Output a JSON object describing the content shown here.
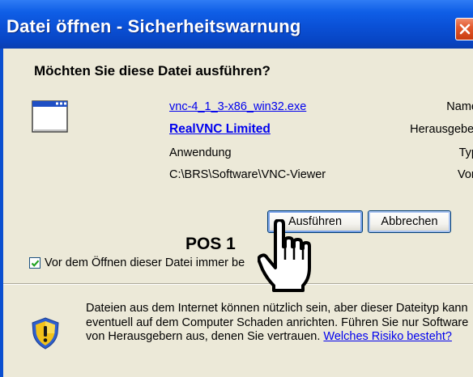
{
  "dialog": {
    "title": "Datei öffnen - Sicherheitswarnung",
    "question": "Möchten Sie diese Datei ausführen?"
  },
  "file_info": {
    "name_label": "Name:",
    "name_value": "vnc-4_1_3-x86_win32.exe",
    "publisher_label": "Herausgeber:",
    "publisher_value": "RealVNC Limited",
    "type_label": "Typ:",
    "type_value": "Anwendung",
    "from_label": "Von:",
    "from_value": "C:\\BRS\\Software\\VNC-Viewer"
  },
  "buttons": {
    "run_label": "Ausführen",
    "cancel_label": "Abbrechen"
  },
  "checkbox": {
    "label": "Vor dem Öffnen dieser Datei immer be",
    "checked": true
  },
  "warning": {
    "text": "Dateien aus dem Internet können nützlich sein, aber dieser Dateityp kann eventuell auf dem Computer Schaden anrichten. Führen Sie nur Software von Herausgebern aus, denen Sie vertrauen. ",
    "link": "Welches Risiko besteht?"
  },
  "annotation": {
    "label": "POS 1"
  },
  "icons": {
    "close": "close-icon",
    "app": "application-window-icon",
    "warning": "security-shield-icon",
    "cursor": "hand-pointer-cursor-icon"
  },
  "colors": {
    "titlebar": "#0a50d6",
    "dialog_bg": "#ece9d8",
    "link": "#0000ee",
    "close_button": "#e25a2e",
    "shield": "#f2c21a"
  }
}
